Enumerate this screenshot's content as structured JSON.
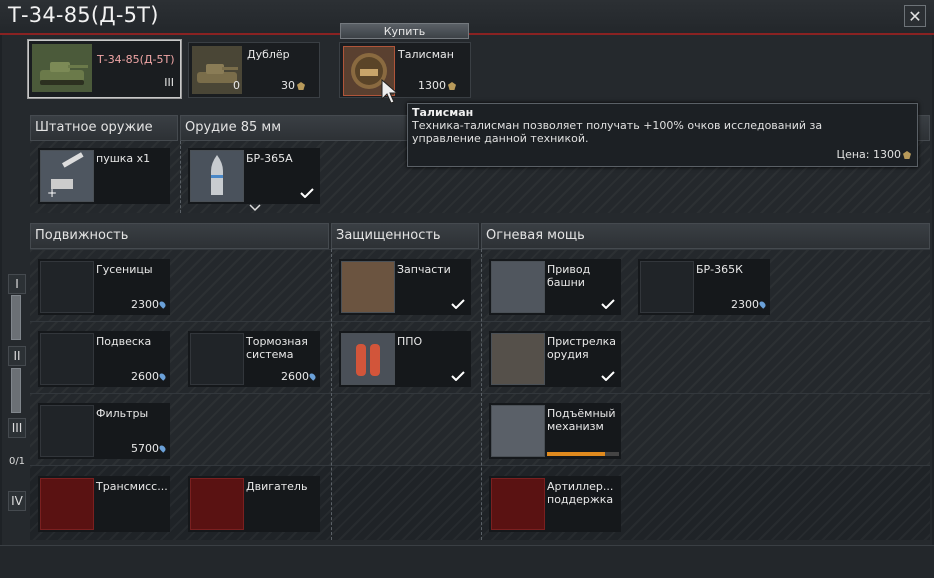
{
  "window": {
    "title": "Т-34-85(Д-5Т)",
    "close_label": "✕"
  },
  "top": {
    "buy_label": "Купить",
    "vehicles": [
      {
        "name": "Т-34-85(Д-5Т)",
        "rank": "III"
      },
      {
        "name": "Дублёр",
        "count": "0",
        "cost": "30"
      },
      {
        "name": "Талисман",
        "cost": "1300"
      }
    ]
  },
  "weapons": {
    "stock_header": "Штатное оружие",
    "gun_header": "Орудие 85 мм",
    "stock_item": {
      "name": "пушка x1"
    },
    "gun_item": {
      "name": "БР-365А"
    }
  },
  "tooltip": {
    "title": "Талисман",
    "body": "Техника-талисман позволяет получать +100% очков исследований за управление данной техникой.",
    "price_label": "Цена:",
    "price_value": "1300"
  },
  "sections": {
    "mobility": "Подвижность",
    "protection": "Защищенность",
    "firepower": "Огневая мощь"
  },
  "tiers": [
    "I",
    "II",
    "III",
    "IV"
  ],
  "tier_counter": "0/1",
  "modules": {
    "mobility": [
      {
        "name": "Гусеницы",
        "cost": "2300"
      },
      {
        "name": "Подвеска",
        "cost": "2600"
      },
      {
        "name": "Тормозная\nсистема",
        "cost": "2600"
      },
      {
        "name": "Фильтры",
        "cost": "5700"
      },
      {
        "name": "Трансмисс...",
        "cost": ""
      },
      {
        "name": "Двигатель",
        "cost": ""
      }
    ],
    "protection": [
      {
        "name": "Запчасти"
      },
      {
        "name": "ППО"
      }
    ],
    "firepower": [
      {
        "name": "Привод\nбашни"
      },
      {
        "name": "БР-365К",
        "cost": "2300"
      },
      {
        "name": "Пристрелка\nорудия"
      },
      {
        "name": "Подъёмный\nмеханизм",
        "progress": 0.8
      },
      {
        "name": "Артиллер...\nподдержка"
      }
    ]
  },
  "colors": {
    "accent_red": "#8a2222",
    "research_blue": "#6aa0d8",
    "progress_orange": "#e08a1e"
  }
}
